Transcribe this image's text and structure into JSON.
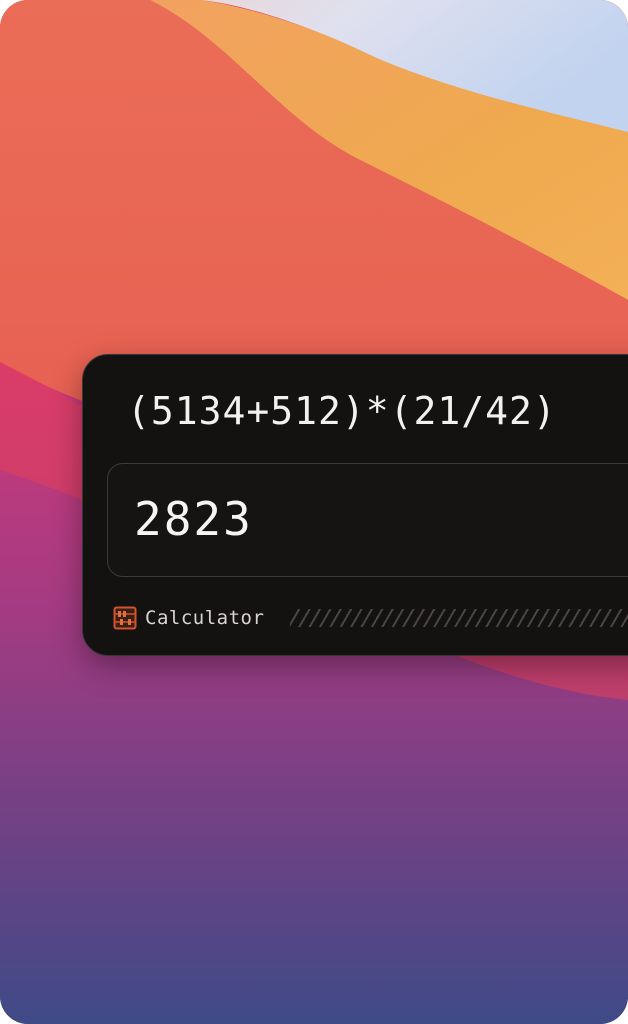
{
  "wallpaper": {
    "colors": {
      "sky": "#c9d5ee",
      "orange": "#f0a95a",
      "coral": "#e86856",
      "red": "#e23f5e",
      "magenta": "#cc3b7b",
      "purple": "#6e4284",
      "navy": "#3d4a86"
    }
  },
  "calculator": {
    "query": "(5134+512)*(21/42)",
    "result": "2823",
    "source_label": "Calculator",
    "source_icon": "abacus-icon",
    "colors": {
      "panel_bg": "#141111",
      "text": "#f2f0f0",
      "icon_accent": "#d2542a"
    }
  }
}
